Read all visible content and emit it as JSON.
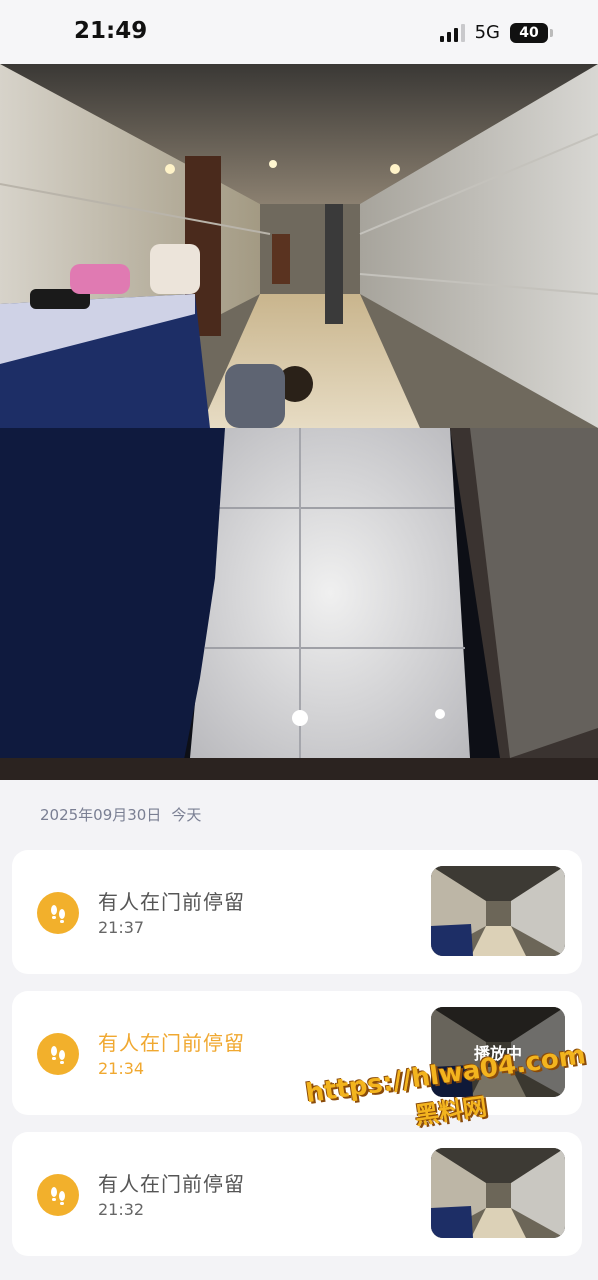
{
  "status_bar": {
    "time": "21:49",
    "network": "5G",
    "battery": "40"
  },
  "camera": {
    "description_icon": "doorbell-camera-feed"
  },
  "section": {
    "date": "2025年09月30日",
    "day_label": "今天"
  },
  "events": [
    {
      "title": "有人在门前停留",
      "time": "21:37",
      "active": false,
      "thumb_label": ""
    },
    {
      "title": "有人在门前停留",
      "time": "21:34",
      "active": true,
      "thumb_label": "播放中"
    },
    {
      "title": "有人在门前停留",
      "time": "21:32",
      "active": false,
      "thumb_label": ""
    }
  ],
  "watermark": {
    "url": "https://hlwa04.com",
    "name": "黑料网"
  },
  "colors": {
    "accent": "#f2b02c",
    "active_text": "#f0a830"
  }
}
